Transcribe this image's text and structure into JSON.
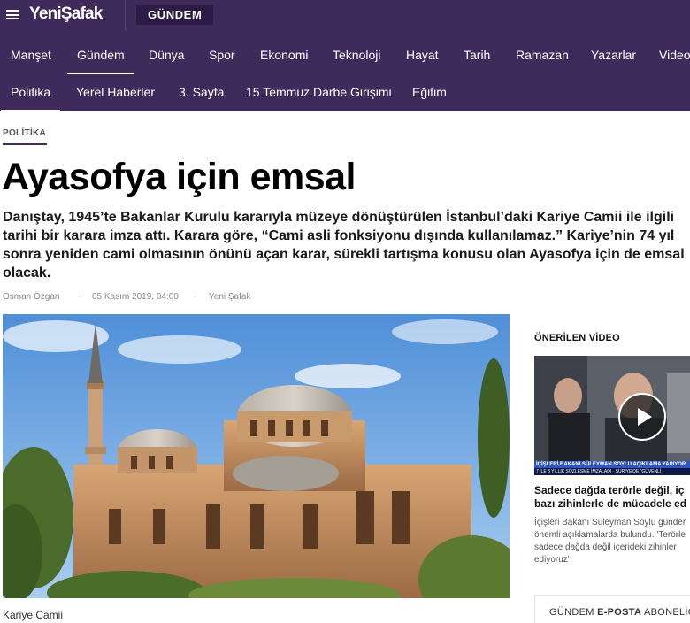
{
  "header": {
    "logo_text": "YeniŞafak",
    "section_label": "GÜNDEM"
  },
  "nav": {
    "row1": [
      "Manşet",
      "Gündem",
      "Dünya",
      "Spor",
      "Ekonomi",
      "Teknoloji",
      "Hayat",
      "Tarih",
      "Ramazan",
      "Yazarlar",
      "Video"
    ],
    "row2": [
      "Politika",
      "Yerel Haberler",
      "3. Sayfa",
      "15 Temmuz Darbe Girişimi",
      "Eğitim"
    ],
    "active_row1": "Gündem",
    "active_row2": "Politika"
  },
  "article": {
    "category": "POLİTİKA",
    "headline": "Ayasofya için emsal",
    "summary_lines": [
      "Danıştay, 1945’te Bakanlar Kurulu kararıyla müzeye dönüştürülen İstanbul’daki Kariye Camii ile ilgili",
      "tarihi bir karara imza attı. Karara göre, “Cami asli fonksiyonu dışında kullanılamaz.” Kariye’nin 74 yıl",
      "sonra yeniden cami olmasının önünü açan karar, sürekli tartışma konusu olan Ayasofya için de emsal",
      "olacak."
    ],
    "author": "Osman Özgan",
    "date": "05 Kasım 2019, 04:00",
    "source": "Yeni Şafak",
    "separator": "·",
    "image_caption": "Kariye Camii"
  },
  "sidebar": {
    "section_title": "ÖNERİLEN VİDEO",
    "video_ticker_top": "İÇİŞLERİ BAKANI SÜLEYMAN SOYLU AÇIKLAMA YAPIYOR",
    "video_ticker_bottom": "7 İLE 3 YILLIK SÖZLEŞME İMZALADI · SURİYE'DE \"GÜVENLİ",
    "video_title_lines": [
      "Sadece dağda terörle değil, iç",
      "bazı zihinlerle de mücadele ed"
    ],
    "video_desc_lines": [
      "İçişleri Bakanı Süleyman Soylu günder",
      "önemli açıklamalarda bulundu. 'Terörle",
      "sadece dağda değil içerideki zihinler",
      "ediyoruz'"
    ],
    "newsletter_prefix": "GÜNDEM",
    "newsletter_bold": "E-POSTA",
    "newsletter_suffix": "ABONELİĞ"
  },
  "colors": {
    "brand_purple": "#3f2a5c",
    "pill_dark": "#2c1b44"
  }
}
